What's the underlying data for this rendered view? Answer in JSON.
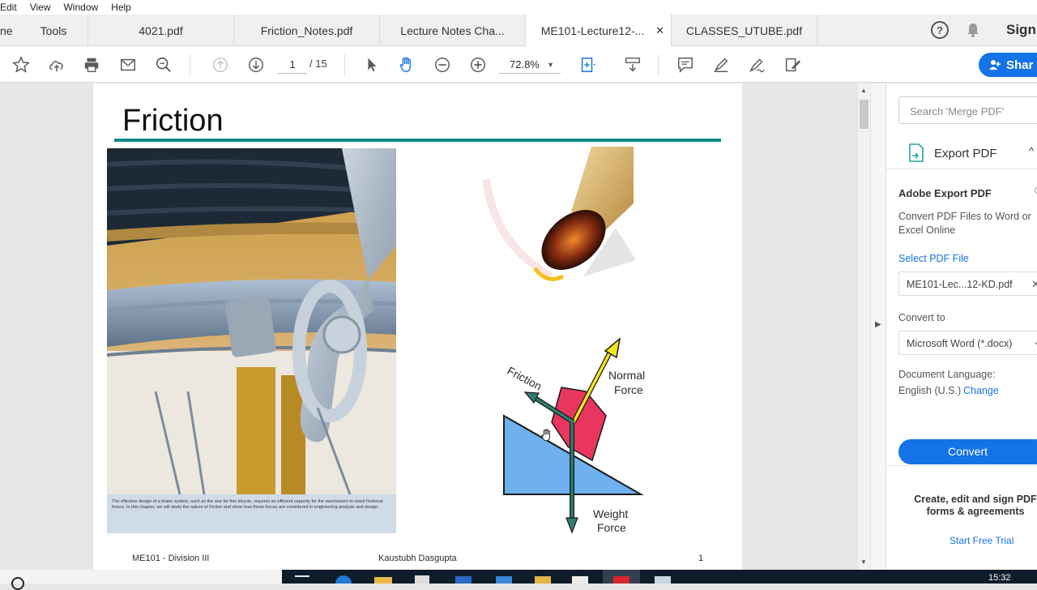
{
  "menu": [
    "Edit",
    "View",
    "Window",
    "Help"
  ],
  "tabs": {
    "home": "ne",
    "tools": "Tools",
    "items": [
      "4021.pdf",
      "Friction_Notes.pdf",
      "Lecture Notes Cha...",
      "ME101-Lecture12-...",
      "CLASSES_UTUBE.pdf"
    ],
    "close": "✕",
    "sign_in": "Sign"
  },
  "toolbar": {
    "page_current": "1",
    "page_total": "/ 15",
    "zoom": "72.8%",
    "share": "Shar"
  },
  "slide": {
    "title": "Friction",
    "caption": "The effective design of a brake system, such as the one for this bicycle, requires an efficient capacity for the mechanism to resist frictional forces. In this chapter, we will study the nature of friction and show how these forces are considered in engineering analysis and design.",
    "label_friction": "Friction",
    "label_normal_1": "Normal",
    "label_normal_2": "Force",
    "label_weight_1": "Weight",
    "label_weight_2": "Force",
    "footer_left": "ME101 - Division III",
    "footer_center": "Kaustubh Dasgupta",
    "footer_right": "1"
  },
  "panel": {
    "search_placeholder": "Search 'Merge PDF'",
    "export_title": "Export PDF",
    "heading": "Adobe Export PDF",
    "description": "Convert PDF Files to Word or Excel Online",
    "select_label": "Select PDF File",
    "file_name": "ME101-Lec...12-KD.pdf",
    "convert_to_label": "Convert to",
    "convert_to_value": "Microsoft Word (*.docx)",
    "doc_lang_label": "Document Language:",
    "doc_lang_value": "English (U.S.)",
    "change_link": "Change",
    "convert_button": "Convert",
    "promo": "Create, edit and sign PDF forms & agreements",
    "trial_link": "Start Free Trial"
  },
  "taskbar": {
    "clock": "15:32"
  },
  "colors": {
    "accent_blue": "#1473e6",
    "title_rule": "#128a8a",
    "arrow_green": "#2e7d70",
    "normal_arrow": "#f5e61c",
    "block": "#e8365e",
    "incline": "#6fb1ef"
  }
}
